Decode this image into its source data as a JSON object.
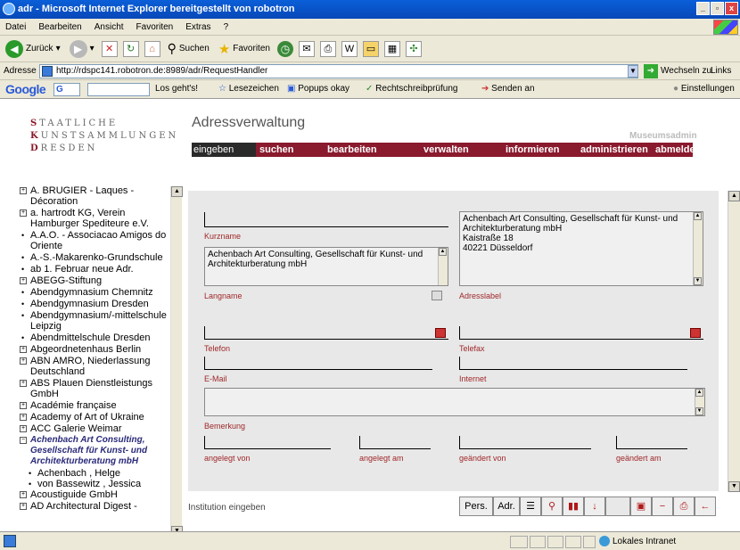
{
  "window": {
    "title": "adr - Microsoft Internet Explorer bereitgestellt von robotron",
    "btn_min": "_",
    "btn_max": "▫",
    "btn_close": "x"
  },
  "menu": [
    "Datei",
    "Bearbeiten",
    "Ansicht",
    "Favoriten",
    "Extras",
    "?"
  ],
  "toolbar": {
    "back": "Zurück",
    "search": "Suchen",
    "favorites": "Favoriten"
  },
  "address": {
    "label": "Adresse",
    "url": "http://rdspc141.robotron.de:8989/adr/RequestHandler",
    "go": "Wechseln zu",
    "links": "Links"
  },
  "google": {
    "logo": "Google",
    "g": "G",
    "items": [
      "Los geht's!",
      "Lesezeichen",
      "Popups okay",
      "Rechtschreibprüfung",
      "Senden an",
      "Einstellungen"
    ]
  },
  "logo": {
    "lines": [
      {
        "first": "S",
        "rest": "TAATLICHE"
      },
      {
        "first": "K",
        "rest": "UNSTSAMMLUNGEN"
      },
      {
        "first": "D",
        "rest": "RESDEN"
      }
    ]
  },
  "app": {
    "title": "Adressverwaltung",
    "user": "Museumsadmin"
  },
  "nav": [
    "eingeben",
    "suchen",
    "bearbeiten",
    "verwalten",
    "informieren",
    "administrieren",
    "abmelden"
  ],
  "tree": [
    {
      "kind": "box",
      "lines": [
        "A. BRUGIER - Laques -",
        "Décoration"
      ]
    },
    {
      "kind": "box",
      "lines": [
        "a. hartrodt KG, Verein",
        "Hamburger Spediteure e.V."
      ]
    },
    {
      "kind": "dot",
      "lines": [
        "A.A.O. - Associacao Amigos do",
        "Oriente"
      ]
    },
    {
      "kind": "dot",
      "lines": [
        "A.-S.-Makarenko-Grundschule"
      ]
    },
    {
      "kind": "dot",
      "lines": [
        "ab 1. Februar neue Adr."
      ]
    },
    {
      "kind": "box",
      "lines": [
        "ABEGG-Stiftung"
      ]
    },
    {
      "kind": "dot",
      "lines": [
        "Abendgymnasium Chemnitz"
      ]
    },
    {
      "kind": "dot",
      "lines": [
        "Abendgymnasium Dresden"
      ]
    },
    {
      "kind": "dot",
      "lines": [
        "Abendgymnasium/-mittelschule",
        "Leipzig"
      ]
    },
    {
      "kind": "dot",
      "lines": [
        "Abendmittelschule Dresden"
      ]
    },
    {
      "kind": "box",
      "lines": [
        "Abgeordnetenhaus Berlin"
      ]
    },
    {
      "kind": "box",
      "lines": [
        "ABN AMRO, Niederlassung",
        "Deutschland"
      ]
    },
    {
      "kind": "box",
      "lines": [
        "ABS Plauen Dienstleistungs",
        "GmbH"
      ]
    },
    {
      "kind": "box",
      "lines": [
        "Académie française"
      ]
    },
    {
      "kind": "box",
      "lines": [
        "Academy of Art of Ukraine"
      ]
    },
    {
      "kind": "box",
      "lines": [
        "ACC Galerie Weimar"
      ]
    },
    {
      "kind": "open",
      "lines": [
        "Achenbach Art Consulting,",
        "Gesellschaft für Kunst- und",
        "Architekturberatung mbH"
      ]
    },
    {
      "kind": "sub",
      "lines": [
        "Achenbach , Helge"
      ]
    },
    {
      "kind": "sub",
      "lines": [
        "von Bassewitz , Jessica"
      ]
    },
    {
      "kind": "box",
      "lines": [
        "Acoustiguide GmbH"
      ]
    },
    {
      "kind": "box",
      "lines": [
        "AD Architectural Digest -"
      ]
    }
  ],
  "form": {
    "kurzname_label": "Kurzname",
    "langname_label": "Langname",
    "langname_value": [
      "Achenbach Art Consulting, Gesellschaft für Kunst- und",
      "Architekturberatung mbH"
    ],
    "adresslabel_label": "Adresslabel",
    "adresslabel_value": [
      "Achenbach Art Consulting, Gesellschaft für Kunst- und",
      "Architekturberatung mbH",
      "Kaistraße 18",
      "40221 Düsseldorf"
    ],
    "telefon_label": "Telefon",
    "telefax_label": "Telefax",
    "email_label": "E-Mail",
    "internet_label": "Internet",
    "bemerkung_label": "Bemerkung",
    "angelegt_von_label": "angelegt von",
    "angelegt_am_label": "angelegt am",
    "geaendert_von_label": "geändert von",
    "geaendert_am_label": "geändert am"
  },
  "footer": {
    "status_text": "Institution eingeben",
    "pers": "Pers.",
    "adr": "Adr."
  },
  "statusbar": {
    "zone": "Lokales Intranet"
  }
}
